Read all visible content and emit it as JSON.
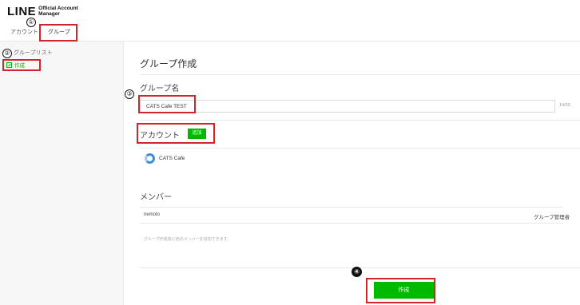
{
  "header": {
    "logo_main": "LINE",
    "logo_sub_line1": "Official Account",
    "logo_sub_line2": "Manager",
    "tabs": [
      {
        "label": "アカウント"
      },
      {
        "label": "グループ",
        "active": true
      }
    ]
  },
  "sidebar": {
    "title": "グループリスト",
    "items": [
      {
        "label": "作成",
        "icon": "edit-icon"
      }
    ]
  },
  "main": {
    "page_title": "グループ作成",
    "group_name_label": "グループ名",
    "group_name_value": "CATS Cafe TEST",
    "group_name_counter": "14/50",
    "account_label": "アカウント",
    "add_button_label": "追加",
    "account_name": "CATS Cafe",
    "member_label": "メンバー",
    "member_name": "nemoto",
    "member_role": "グループ管理者",
    "member_hint": "グループ作成後に他のメンバーを追加できます。",
    "create_button_label": "作成"
  },
  "annotations": {
    "marks": [
      "①",
      "②",
      "③",
      "④"
    ]
  },
  "colors": {
    "accent": "#00b900",
    "annotation": "#d1252b",
    "sidebar_bg": "#f7f7f7"
  }
}
